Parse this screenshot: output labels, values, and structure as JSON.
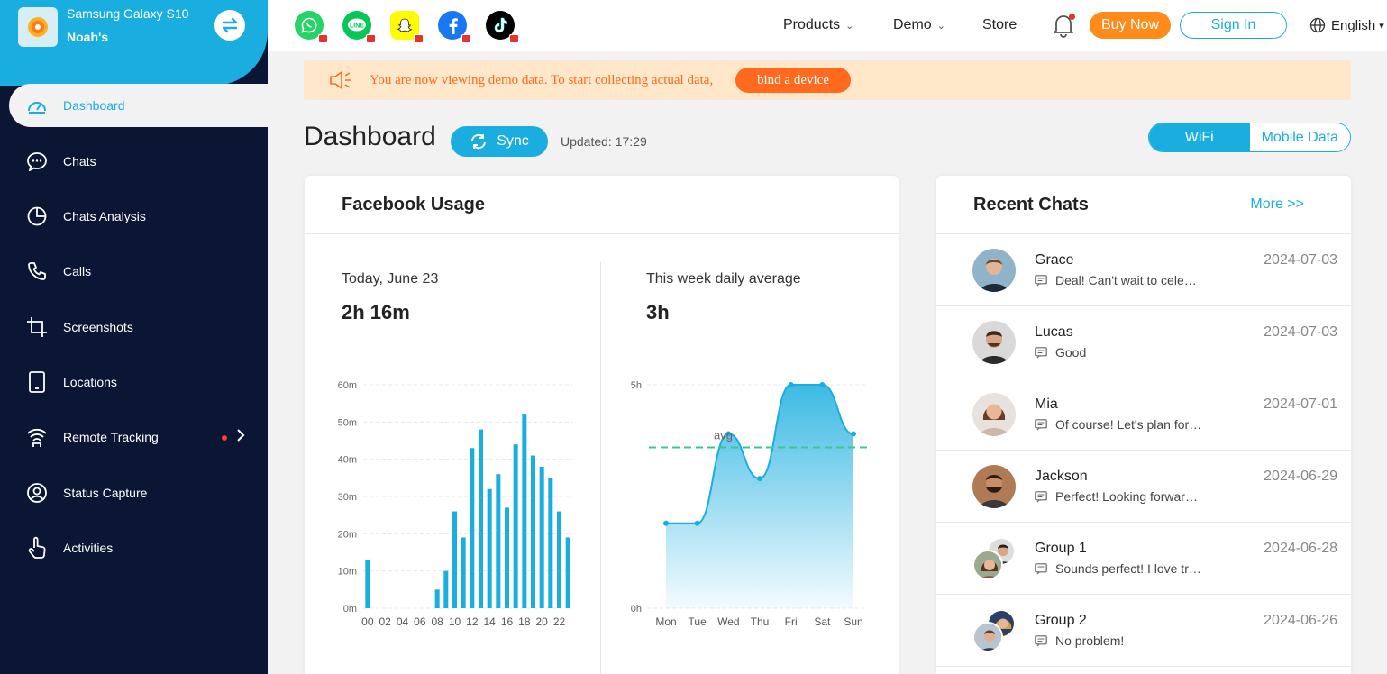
{
  "device": {
    "name": "Samsung Galaxy S10",
    "owner": "Noah's"
  },
  "sidebar": {
    "items": [
      {
        "label": "Dashboard",
        "icon": "gauge-icon",
        "active": true
      },
      {
        "label": "Chats",
        "icon": "chat-bubble-icon"
      },
      {
        "label": "Chats Analysis",
        "icon": "pie-chart-icon"
      },
      {
        "label": "Calls",
        "icon": "phone-icon"
      },
      {
        "label": "Screenshots",
        "icon": "crop-icon"
      },
      {
        "label": "Locations",
        "icon": "phone-device-icon"
      },
      {
        "label": "Remote Tracking",
        "icon": "wifi-tower-icon",
        "badge": true,
        "arrow": true
      },
      {
        "label": "Status Capture",
        "icon": "user-circle-icon"
      },
      {
        "label": "Activities",
        "icon": "hand-pointer-icon"
      }
    ]
  },
  "header": {
    "apps": [
      {
        "name": "whatsapp-icon",
        "color": "#25d366"
      },
      {
        "name": "line-icon",
        "color": "#06c755"
      },
      {
        "name": "snapchat-icon",
        "color": "#fffc00"
      },
      {
        "name": "facebook-icon",
        "color": "#1877f2"
      },
      {
        "name": "tiktok-icon",
        "color": "#000000"
      }
    ],
    "menu": [
      "Products",
      "Demo",
      "Store"
    ],
    "buy_label": "Buy Now",
    "sign_label": "Sign In",
    "language": "English"
  },
  "banner": {
    "text": "You are now viewing demo data. To start collecting actual data,",
    "button": "bind a device"
  },
  "dashboard": {
    "title": "Dashboard",
    "sync_label": "Sync",
    "updated": "Updated: 17:29",
    "tabs": [
      "WiFi",
      "Mobile Data"
    ]
  },
  "usage": {
    "title": "Facebook Usage",
    "today_label": "Today, June 23",
    "today_value": "2h 16m",
    "week_label": "This week daily average",
    "week_value": "3h"
  },
  "chart_data": [
    {
      "type": "bar",
      "yticks": [
        "60m",
        "50m",
        "40m",
        "30m",
        "20m",
        "10m",
        "0m"
      ],
      "ylim": [
        0,
        60
      ],
      "xticks": [
        "00",
        "02",
        "04",
        "06",
        "08",
        "10",
        "12",
        "14",
        "16",
        "18",
        "20",
        "22"
      ],
      "categories": [
        0,
        1,
        2,
        3,
        4,
        5,
        6,
        7,
        8,
        9,
        10,
        11,
        12,
        13,
        14,
        15,
        16,
        17,
        18,
        19,
        20,
        21,
        22,
        23
      ],
      "values": [
        13,
        0,
        0,
        0,
        0,
        0,
        0,
        0,
        5,
        10,
        26,
        19,
        43,
        48,
        32,
        36,
        27,
        44,
        52,
        41,
        38,
        35,
        26,
        19
      ],
      "color": "#1aaee0"
    },
    {
      "type": "area",
      "categories": [
        "Mon",
        "Tue",
        "Wed",
        "Thu",
        "Fri",
        "Sat",
        "Sun"
      ],
      "values": [
        1.9,
        1.9,
        3.9,
        2.9,
        5.0,
        5.0,
        3.9
      ],
      "yticks": [
        "5h",
        "0h"
      ],
      "ylim": [
        0,
        5
      ],
      "avg": 3.6,
      "avg_label": "avg",
      "color": "#1aaee0",
      "avg_color": "#3cc88a"
    }
  ],
  "recent_chats": {
    "title": "Recent Chats",
    "more": "More >>",
    "items": [
      {
        "name": "Grace",
        "message": "Deal! Can't wait to cele…",
        "date": "2024-07-03"
      },
      {
        "name": "Lucas",
        "message": "Good",
        "date": "2024-07-03"
      },
      {
        "name": "Mia",
        "message": "Of course! Let's plan for…",
        "date": "2024-07-01"
      },
      {
        "name": "Jackson",
        "message": "Perfect! Looking forwar…",
        "date": "2024-06-29"
      },
      {
        "name": "Group 1",
        "message": "Sounds perfect! I love tr…",
        "date": "2024-06-28"
      },
      {
        "name": "Group 2",
        "message": "No problem!",
        "date": "2024-06-26"
      }
    ]
  }
}
